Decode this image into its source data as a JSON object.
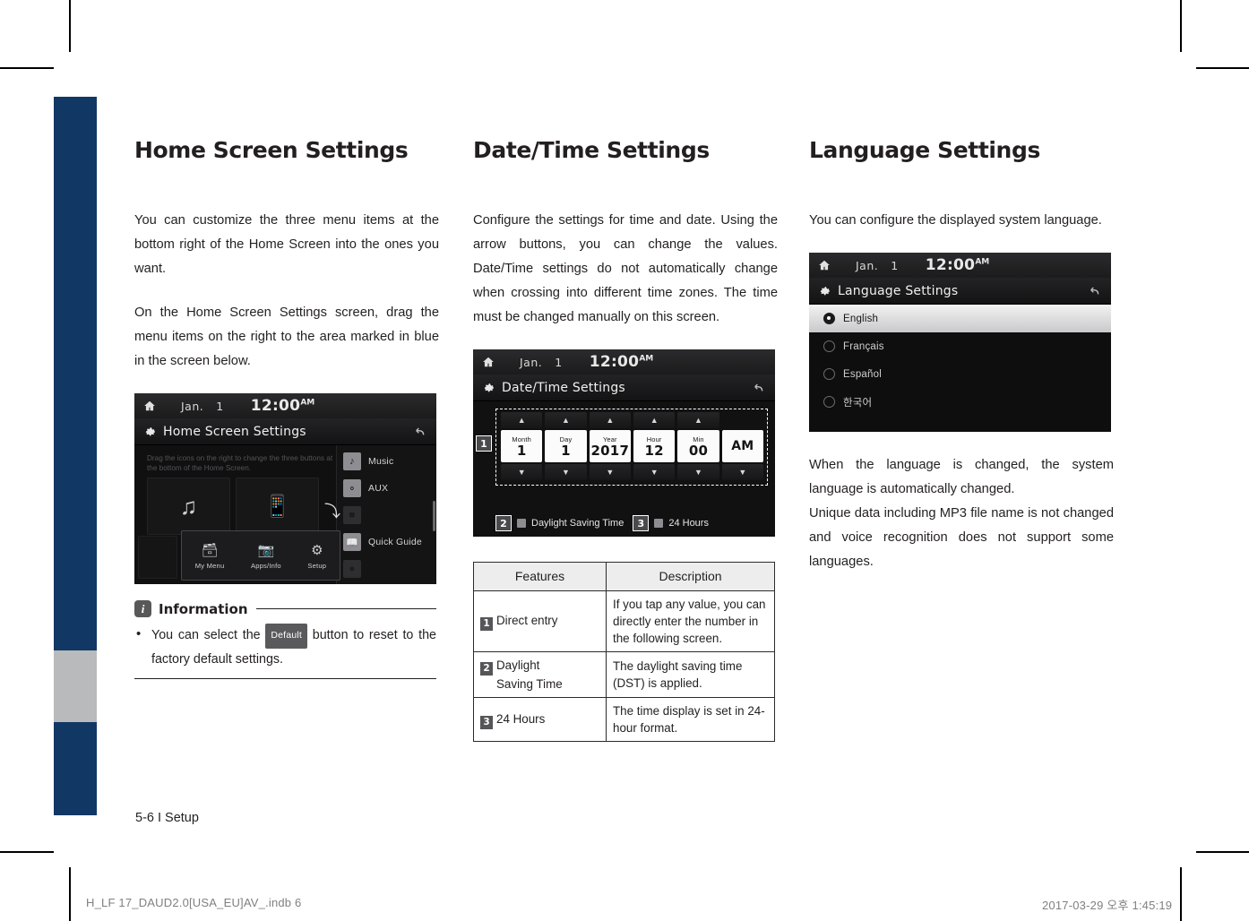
{
  "document": {
    "page_footer": "5-6 I Setup",
    "print_footer_left": "H_LF 17_DAUD2.0[USA_EU]AV_.indb   6",
    "print_footer_right": "2017-03-29   오후 1:45:19",
    "spine_color": "#113765",
    "spine_band_color": "#b9babc"
  },
  "col1": {
    "title": "Home Screen Settings",
    "para1": "You can customize the three menu items at the bottom right of the Home Screen into the ones you want.",
    "para2": "On the Home Screen Settings screen, drag the menu items on the right to the area marked in blue in the screen below.",
    "device": {
      "status_date_label": "Jan.",
      "status_date_num": "1",
      "status_time": "12:00",
      "status_ampm": "AM",
      "title": "Home Screen Settings",
      "hint": "Drag the icons on the right to change the three buttons at the bottom of the Home Screen.",
      "dock": [
        {
          "label": "My Menu",
          "icon": "folder-icon"
        },
        {
          "label": "Apps/Info",
          "icon": "camera-icon"
        },
        {
          "label": "Setup",
          "icon": "gear-icon"
        }
      ],
      "list": [
        {
          "label": "Music",
          "icon": "music-note-icon",
          "faded": false
        },
        {
          "label": "AUX",
          "icon": "aux-cable-icon",
          "faded": false
        },
        {
          "label": "",
          "icon": "radio-icon",
          "faded": true
        },
        {
          "label": "Quick Guide",
          "icon": "book-icon",
          "faded": false
        },
        {
          "label": "",
          "icon": "phone-icon",
          "faded": true
        }
      ]
    },
    "information": {
      "badge": "i",
      "label": "Information",
      "bullet_before": "You can select the",
      "button_label": "Default",
      "bullet_after": "button to reset to the factory default settings."
    }
  },
  "col2": {
    "title": "Date/Time Settings",
    "para1": "Configure the settings for time and date. Using the arrow buttons, you can change the values. Date/Time settings do not automatically change when crossing into different time zones. The time must be changed manually on this screen.",
    "device": {
      "status_date_label": "Jan.",
      "status_date_num": "1",
      "status_time": "12:00",
      "status_ampm": "AM",
      "title": "Date/Time Settings",
      "fields": [
        {
          "caption": "Month",
          "value": "1"
        },
        {
          "caption": "Day",
          "value": "1"
        },
        {
          "caption": "Year",
          "value": "2017"
        },
        {
          "caption": "Hour",
          "value": "12"
        },
        {
          "caption": "Min",
          "value": "00"
        },
        {
          "caption": "",
          "value": "AM"
        }
      ],
      "callout_entry": "1",
      "callout_dst": "2",
      "dst_label": "Daylight Saving Time",
      "callout_24h": "3",
      "hours24_label": "24 Hours"
    },
    "table": {
      "headers": [
        "Features",
        "Description"
      ],
      "rows": [
        {
          "num": "1",
          "feature": "Direct entry",
          "feature_line2": "",
          "description": "If you tap any value, you can directly enter the number in the following screen."
        },
        {
          "num": "2",
          "feature": "Daylight",
          "feature_line2": "Saving Time",
          "description": "The daylight saving time (DST) is applied."
        },
        {
          "num": "3",
          "feature": "24 Hours",
          "feature_line2": "",
          "description": "The time display is set in 24-hour format."
        }
      ]
    }
  },
  "col3": {
    "title": "Language Settings",
    "para1": "You can configure the displayed system language.",
    "device": {
      "status_date_label": "Jan.",
      "status_date_num": "1",
      "status_time": "12:00",
      "status_ampm": "AM",
      "title": "Language Settings",
      "languages": [
        {
          "label": "English",
          "selected": true
        },
        {
          "label": "Français",
          "selected": false
        },
        {
          "label": "Español",
          "selected": false
        },
        {
          "label": "한국어",
          "selected": false
        }
      ]
    },
    "para2": "When the language is changed, the system language is automatically changed.",
    "para3": "Unique data including MP3 file name is not changed and voice recognition does not support some languages."
  }
}
